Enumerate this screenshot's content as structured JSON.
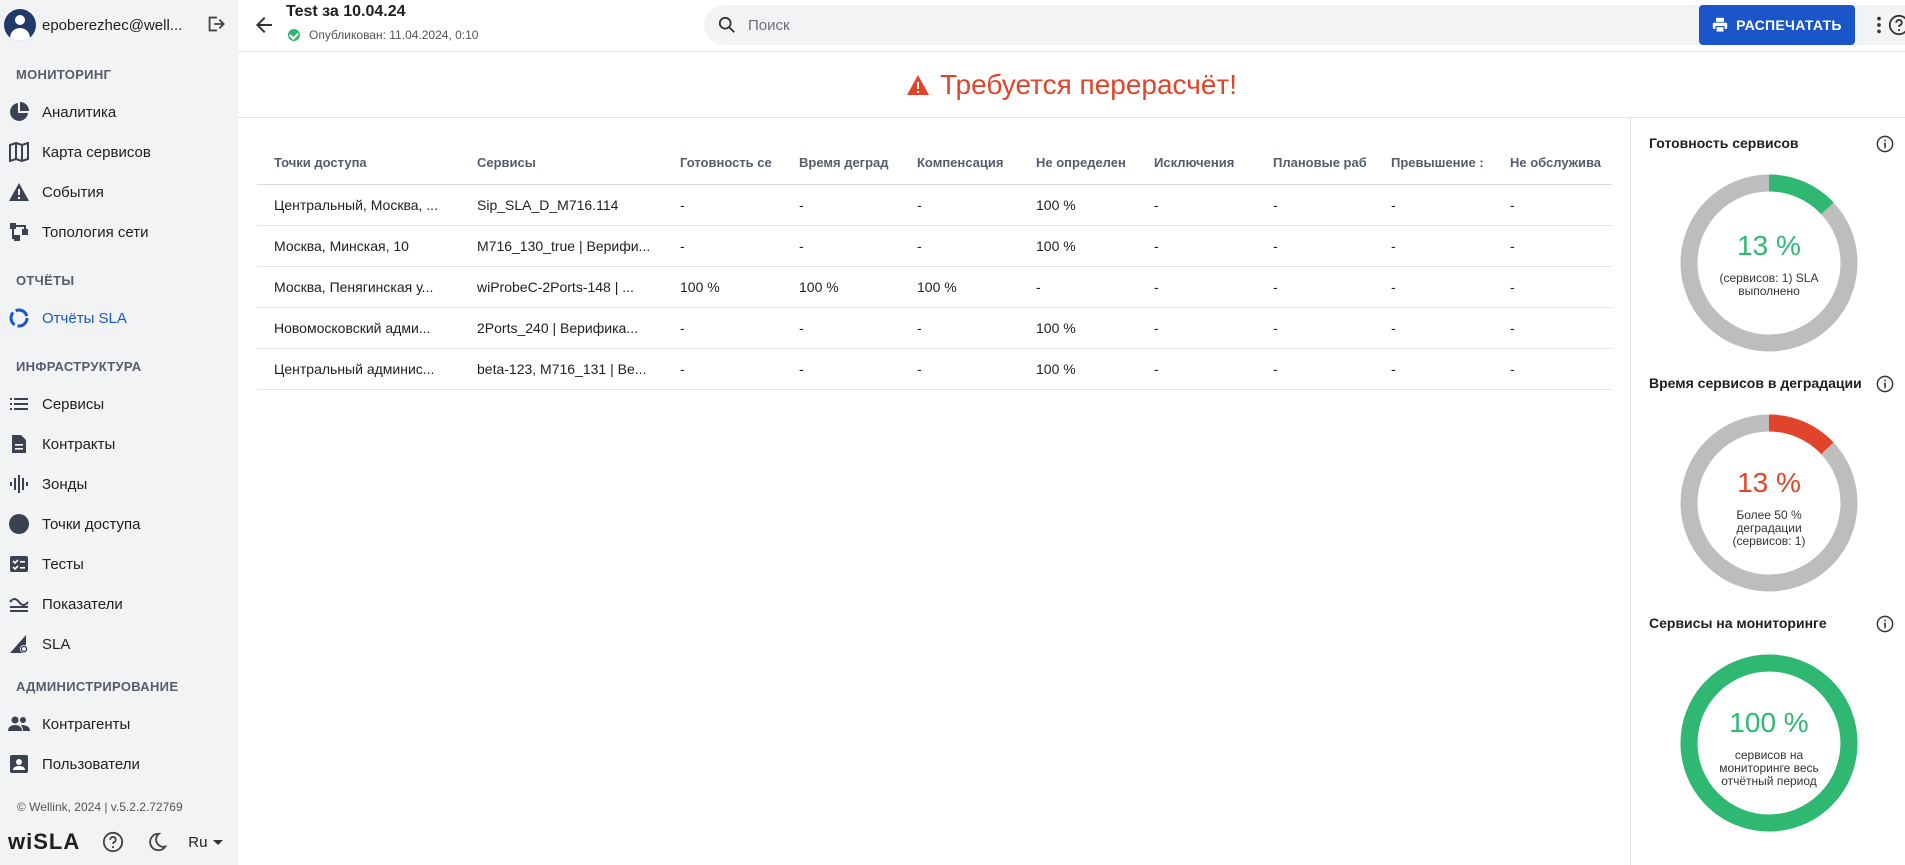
{
  "user": {
    "name": "epoberezhec@well..."
  },
  "sidebar": {
    "sections": [
      {
        "title": "МОНИТОРИНГ"
      },
      {
        "title": "ОТЧЁТЫ"
      },
      {
        "title": "ИНФРАСТРУКТУРА"
      },
      {
        "title": "АДМИНИСТРИРОВАНИЕ"
      }
    ],
    "items": [
      {
        "label": "Аналитика",
        "icon": "pie-chart-icon"
      },
      {
        "label": "Карта сервисов",
        "icon": "map-icon"
      },
      {
        "label": "События",
        "icon": "warning-icon"
      },
      {
        "label": "Топология сети",
        "icon": "topology-icon"
      },
      {
        "label": "Отчёты SLA",
        "icon": "report-donut-icon",
        "active": true
      },
      {
        "label": "Сервисы",
        "icon": "list-icon"
      },
      {
        "label": "Контракты",
        "icon": "document-icon"
      },
      {
        "label": "Зонды",
        "icon": "probe-icon"
      },
      {
        "label": "Точки доступа",
        "icon": "access-point-icon"
      },
      {
        "label": "Тесты",
        "icon": "checklist-icon"
      },
      {
        "label": "Показатели",
        "icon": "metrics-icon"
      },
      {
        "label": "SLA",
        "icon": "sla-icon"
      },
      {
        "label": "Контрагенты",
        "icon": "people-icon"
      },
      {
        "label": "Пользователи",
        "icon": "user-card-icon"
      }
    ],
    "footer": {
      "copyright": "© Wellink, 2024 | v.5.2.2.72769",
      "logo": "wiSLA",
      "language": "Ru"
    }
  },
  "header": {
    "title": "Test за 10.04.24",
    "published": "Опубликован: 11.04.2024, 0:10",
    "search_placeholder": "Поиск",
    "print_label": "РАСПЕЧАТАТЬ"
  },
  "banner": {
    "text": "Требуется перерасчёт!"
  },
  "table": {
    "columns": [
      "Точки доступа",
      "Сервисы",
      "Готовность се",
      "Время деград",
      "Компенсация",
      "Не определен",
      "Исключения",
      "Плановые раб",
      "Превышение :",
      "Не обслужива"
    ],
    "rows": [
      [
        "Центральный, Москва, ...",
        "Sip_SLA_D_M716.114",
        "-",
        "-",
        "-",
        "100 %",
        "-",
        "-",
        "-",
        "-"
      ],
      [
        "Москва, Минская, 10",
        "M716_130_true | Верифи...",
        "-",
        "-",
        "-",
        "100 %",
        "-",
        "-",
        "-",
        "-"
      ],
      [
        "Москва, Пенягинская у...",
        "wiProbeC-2Ports-148 | ...",
        "100 %",
        "100 %",
        "100 %",
        "-",
        "-",
        "-",
        "-",
        "-"
      ],
      [
        "Новомосковский адми...",
        "2Ports_240 | Верифика...",
        "-",
        "-",
        "-",
        "100 %",
        "-",
        "-",
        "-",
        "-"
      ],
      [
        "Центральный админис...",
        "beta-123, M716_131 | Be...",
        "-",
        "-",
        "-",
        "100 %",
        "-",
        "-",
        "-",
        "-"
      ]
    ]
  },
  "widgets": [
    {
      "title": "Готовность сервисов",
      "value": "13 %",
      "caption": "(сервисов: 1) SLA выполнено",
      "fraction": 0.13,
      "color": "#2eb872"
    },
    {
      "title": "Время сервисов в деградации",
      "value": "13 %",
      "caption": "Более 50 % деградации (сервисов: 1)",
      "fraction": 0.13,
      "color": "#e0452b"
    },
    {
      "title": "Сервисы на мониторинге",
      "value": "100 %",
      "caption": "сервисов на мониторинге весь отчётный период",
      "fraction": 1.0,
      "color": "#2eb872"
    }
  ],
  "colors": {
    "accent": "#1a55c9",
    "success": "#2eb872",
    "danger": "#e0452b",
    "track": "#bdbdbd"
  }
}
